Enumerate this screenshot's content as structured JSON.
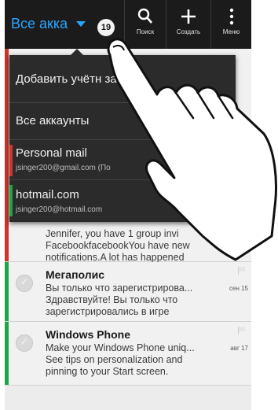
{
  "actionbar": {
    "account_title": "Все акка",
    "unread_count": "19",
    "search_label": "Поиск",
    "compose_label": "Создать",
    "menu_label": "Меню"
  },
  "dropdown": {
    "add_account": "Добавить учётн   запись",
    "all_accounts": "Все аккаунты",
    "accounts": [
      {
        "name": "Personal mail",
        "email": "jsinger200@gmail.com (По",
        "color": "#d0342c"
      },
      {
        "name": "hotmail.com",
        "email": "jsinger200@hotmail.com",
        "color": "#1fa34a"
      }
    ]
  },
  "messages": [
    {
      "lines": [
        "Jennifer, you have 1 group invi",
        "FacebookfacebookYou have new",
        "notifications.A lot has happened"
      ],
      "color": "#d0342c"
    },
    {
      "sender": "Мегаполис",
      "lines": [
        "Вы только что зарегистрирова...",
        "Здравствуйте!  Вы только что",
        "зарегистрировались в игре"
      ],
      "date": "сен 15",
      "color": "#1fa34a"
    },
    {
      "sender": "Windows Phone",
      "lines": [
        "Make your Windows Phone uniq...",
        "See tips on personalization and",
        "pinning to your Start screen."
      ],
      "date": "авг 17",
      "color": "#1fa34a"
    }
  ]
}
